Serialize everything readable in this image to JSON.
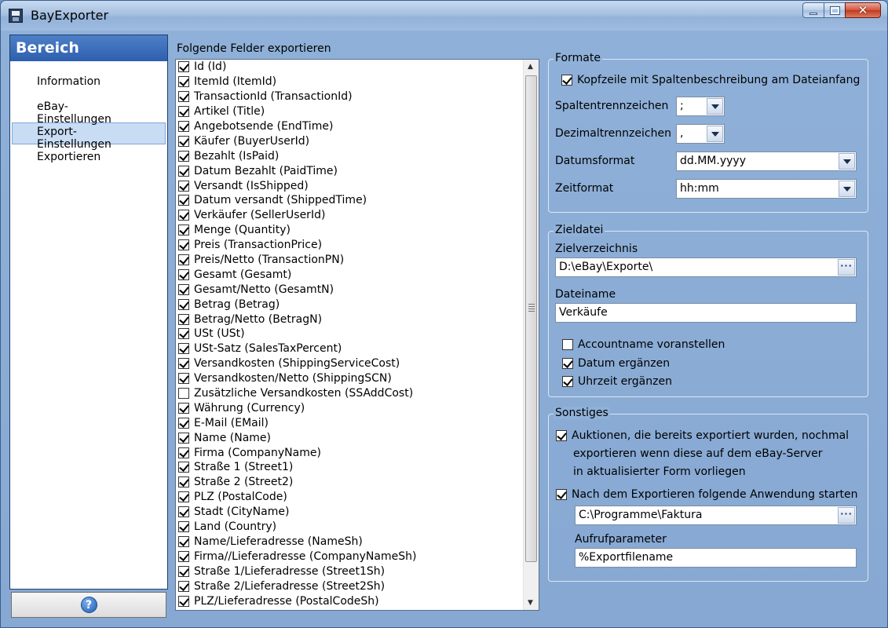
{
  "window": {
    "title": "BayExporter"
  },
  "sidebar": {
    "header": "Bereich",
    "items": [
      {
        "label": "Information",
        "active": false
      },
      {
        "label": "eBay-Einstellungen",
        "active": false
      },
      {
        "label": "Export-Einstellungen",
        "active": true
      },
      {
        "label": "Exportieren",
        "active": false
      }
    ],
    "help_icon": "?"
  },
  "fields": {
    "label": "Folgende Felder exportieren",
    "items": [
      {
        "label": "Id (Id)",
        "checked": true
      },
      {
        "label": "ItemId (ItemId)",
        "checked": true
      },
      {
        "label": "TransactionId (TransactionId)",
        "checked": true
      },
      {
        "label": "Artikel (Title)",
        "checked": true
      },
      {
        "label": "Angebotsende (EndTime)",
        "checked": true
      },
      {
        "label": "Käufer (BuyerUserId)",
        "checked": true
      },
      {
        "label": "Bezahlt (IsPaid)",
        "checked": true
      },
      {
        "label": "Datum Bezahlt (PaidTime)",
        "checked": true
      },
      {
        "label": "Versandt (IsShipped)",
        "checked": true
      },
      {
        "label": "Datum versandt (ShippedTime)",
        "checked": true
      },
      {
        "label": "Verkäufer (SellerUserId)",
        "checked": true
      },
      {
        "label": "Menge (Quantity)",
        "checked": true
      },
      {
        "label": "Preis (TransactionPrice)",
        "checked": true
      },
      {
        "label": "Preis/Netto (TransactionPN)",
        "checked": true
      },
      {
        "label": "Gesamt (Gesamt)",
        "checked": true
      },
      {
        "label": "Gesamt/Netto (GesamtN)",
        "checked": true
      },
      {
        "label": "Betrag (Betrag)",
        "checked": true
      },
      {
        "label": "Betrag/Netto (BetragN)",
        "checked": true
      },
      {
        "label": "USt (USt)",
        "checked": true
      },
      {
        "label": "USt-Satz (SalesTaxPercent)",
        "checked": true
      },
      {
        "label": "Versandkosten (ShippingServiceCost)",
        "checked": true
      },
      {
        "label": "Versandkosten/Netto (ShippingSCN)",
        "checked": true
      },
      {
        "label": "Zusätzliche Versandkosten (SSAddCost)",
        "checked": false
      },
      {
        "label": "Währung (Currency)",
        "checked": true
      },
      {
        "label": "E-Mail (EMail)",
        "checked": true
      },
      {
        "label": "Name (Name)",
        "checked": true
      },
      {
        "label": "Firma (CompanyName)",
        "checked": true
      },
      {
        "label": "Straße 1 (Street1)",
        "checked": true
      },
      {
        "label": "Straße 2 (Street2)",
        "checked": true
      },
      {
        "label": "PLZ (PostalCode)",
        "checked": true
      },
      {
        "label": "Stadt (CityName)",
        "checked": true
      },
      {
        "label": "Land (Country)",
        "checked": true
      },
      {
        "label": "Name/Lieferadresse (NameSh)",
        "checked": true
      },
      {
        "label": "Firma//Lieferadresse (CompanyNameSh)",
        "checked": true
      },
      {
        "label": "Straße 1/Lieferadresse (Street1Sh)",
        "checked": true
      },
      {
        "label": "Straße 2/Lieferadresse (Street2Sh)",
        "checked": true
      },
      {
        "label": "PLZ/Lieferadresse (PostalCodeSh)",
        "checked": true
      }
    ]
  },
  "formate": {
    "title": "Formate",
    "header_row_label": "Kopfzeile mit Spaltenbeschreibung am Dateianfang",
    "header_row_checked": true,
    "column_sep_label": "Spaltentrennzeichen",
    "column_sep_value": ";",
    "decimal_sep_label": "Dezimaltrennzeichen",
    "decimal_sep_value": ",",
    "date_format_label": "Datumsformat",
    "date_format_value": "dd.MM.yyyy",
    "time_format_label": "Zeitformat",
    "time_format_value": "hh:mm"
  },
  "zieldatei": {
    "title": "Zieldatei",
    "dir_label": "Zielverzeichnis",
    "dir_value": "D:\\eBay\\Exporte\\",
    "filename_label": "Dateiname",
    "filename_value": "Verkäufe",
    "accountname_label": "Accountname voranstellen",
    "accountname_checked": false,
    "date_label": "Datum ergänzen",
    "date_checked": true,
    "time_label": "Uhrzeit ergänzen",
    "time_checked": true
  },
  "sonstiges": {
    "title": "Sonstiges",
    "reexport_line1": "Auktionen, die bereits exportiert wurden, nochmal",
    "reexport_line2": "exportieren wenn diese auf dem eBay-Server",
    "reexport_line3": "in aktualisierter Form vorliegen",
    "reexport_checked": true,
    "start_app_label": "Nach dem Exportieren folgende Anwendung starten",
    "start_app_checked": true,
    "app_path_value": "C:\\Programme\\Faktura",
    "params_label": "Aufrufparameter",
    "params_value": "%Exportfilename"
  },
  "buttons": {
    "browse_dots": "···"
  }
}
